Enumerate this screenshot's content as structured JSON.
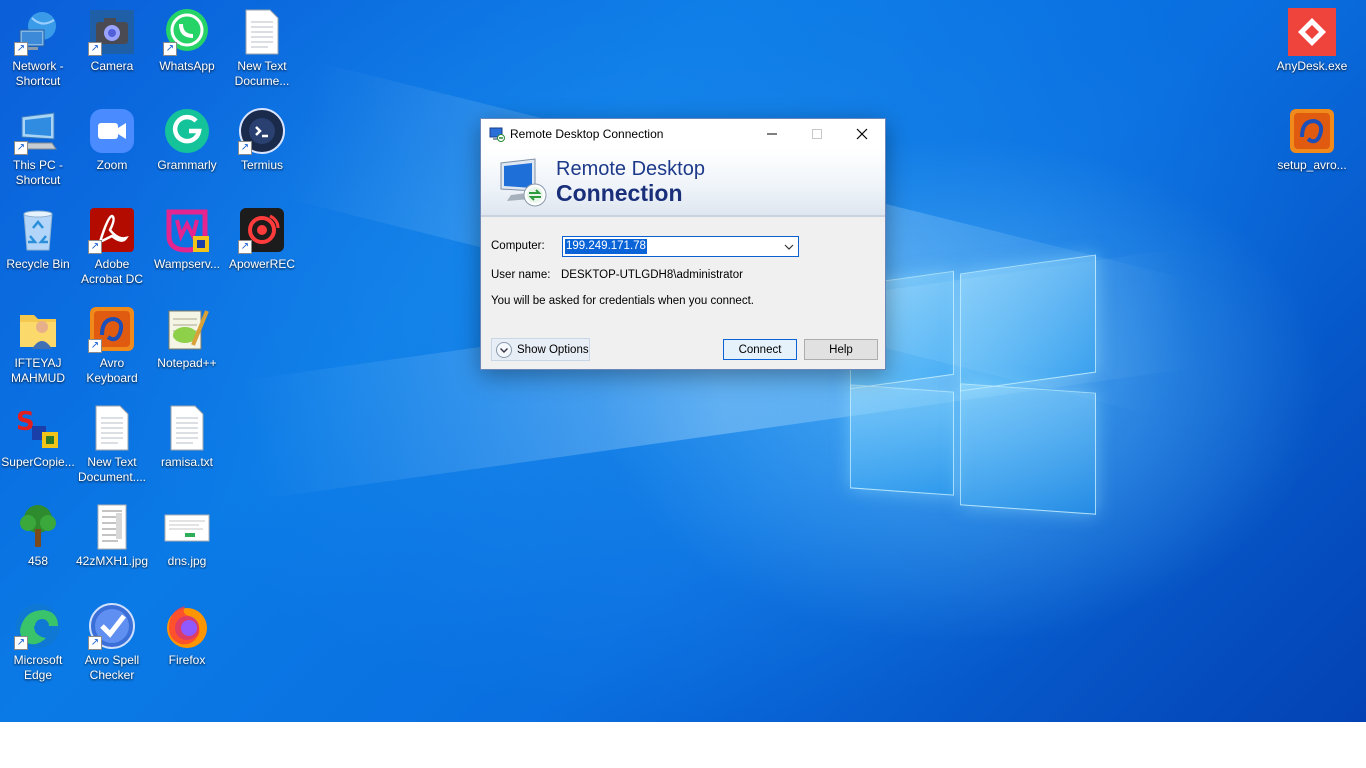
{
  "desktop": {
    "icons": [
      {
        "label": "Network -\nShortcut",
        "icon": "network-icon"
      },
      {
        "label": "Camera",
        "icon": "camera-icon"
      },
      {
        "label": "WhatsApp",
        "icon": "whatsapp-icon"
      },
      {
        "label": "New Text\nDocume...",
        "icon": "text-file-icon"
      },
      {
        "label": "This PC -\nShortcut",
        "icon": "this-pc-icon"
      },
      {
        "label": "Zoom",
        "icon": "zoom-icon"
      },
      {
        "label": "Grammarly",
        "icon": "grammarly-icon"
      },
      {
        "label": "Termius",
        "icon": "termius-icon"
      },
      {
        "label": "Recycle Bin",
        "icon": "recycle-bin-icon"
      },
      {
        "label": "Adobe\nAcrobat DC",
        "icon": "acrobat-icon"
      },
      {
        "label": "Wampserv...",
        "icon": "wampserver-icon"
      },
      {
        "label": "ApowerREC",
        "icon": "apowerrec-icon"
      },
      {
        "label": "IFTEYAJ\nMAHMUD",
        "icon": "user-folder-icon"
      },
      {
        "label": "Avro\nKeyboard",
        "icon": "avro-keyboard-icon"
      },
      {
        "label": "Notepad++",
        "icon": "notepadpp-icon"
      },
      {
        "label": "SuperCopie...",
        "icon": "supercopier-icon"
      },
      {
        "label": "New Text\nDocument....",
        "icon": "text-file-icon"
      },
      {
        "label": "ramisa.txt",
        "icon": "text-file-icon"
      },
      {
        "label": "458",
        "icon": "tree-icon"
      },
      {
        "label": "42zMXH1.jpg",
        "icon": "image-file-icon"
      },
      {
        "label": "dns.jpg",
        "icon": "image-file-icon"
      },
      {
        "label": "Microsoft\nEdge",
        "icon": "edge-icon"
      },
      {
        "label": "Avro Spell\nChecker",
        "icon": "avro-spell-checker-icon"
      },
      {
        "label": "Firefox",
        "icon": "firefox-icon"
      }
    ],
    "right_icons": [
      {
        "label": "AnyDesk.exe",
        "icon": "anydesk-icon"
      },
      {
        "label": "setup_avro...",
        "icon": "avro-setup-icon"
      }
    ]
  },
  "rdc": {
    "title": "Remote Desktop Connection",
    "banner_line1": "Remote Desktop",
    "banner_line2": "Connection",
    "computer_label": "Computer:",
    "computer_value": "199.249.171.78",
    "username_label": "User name:",
    "username_value": "DESKTOP-UTLGDH8\\administrator",
    "info_text": "You will be asked for credentials when you connect.",
    "show_options": "Show Options",
    "connect": "Connect",
    "help": "Help"
  },
  "colors": {
    "wallpaper_blue": "#0a7ae6",
    "dialog_accent": "#0a64d8",
    "anydesk_red": "#ef443b"
  }
}
